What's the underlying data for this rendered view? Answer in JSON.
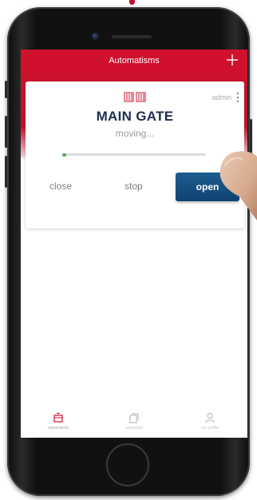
{
  "header": {
    "title": "Automatisms"
  },
  "card": {
    "owner_label": "admin",
    "gate_name": "MAIN GATE",
    "status": "moving...",
    "progress_fraction": 0.03
  },
  "actions": {
    "close_label": "close",
    "stop_label": "stop",
    "open_label": "open"
  },
  "tabs": [
    {
      "label": "automatism",
      "icon": "gate-icon",
      "active": true
    },
    {
      "label": "scenarios",
      "icon": "cards-icon",
      "active": false
    },
    {
      "label": "my profile",
      "icon": "user-icon",
      "active": false
    }
  ],
  "colors": {
    "brand_red": "#c8102e",
    "open_blue": "#154e80",
    "progress_green": "#4caf50",
    "title_navy": "#1b2f4f"
  }
}
